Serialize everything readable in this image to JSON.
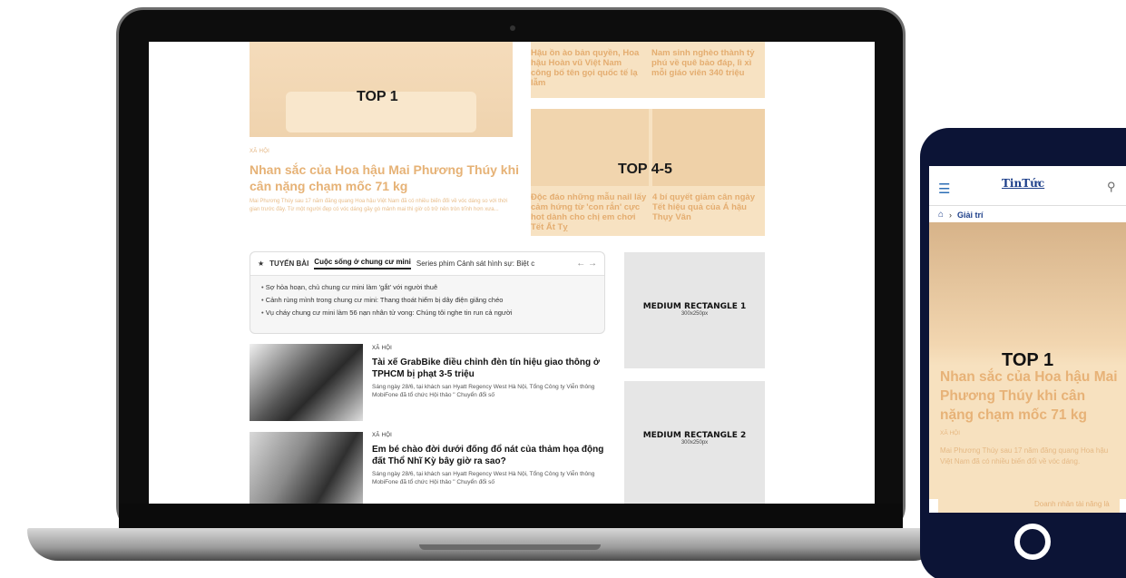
{
  "laptop": {
    "top1_label": "TOP 1",
    "top1_category": "XÃ HỘI",
    "top1_headline": "Nhan sắc của Hoa hậu Mai Phương Thúy khi cân nặng chạm mốc 71 kg",
    "top1_desc": "Mai Phương Thúy sau 17 năm đăng quang Hoa hậu Việt Nam đã có nhiều biến đổi về vóc dáng so với thời gian trước đây. Từ một người đẹp có vóc dáng gầy gò mảnh mai thì giờ cô trở nên tròn trĩnh hơn xưa...",
    "right_top_1": "Hậu ồn ào bản quyền, Hoa hậu Hoàn vũ Việt Nam công bố tên gọi quốc tế lạ lẫm",
    "right_top_2": "Nam sinh nghèo thành tỷ phú về quê bảo đáp, lì xì mỗi giáo viên 340 triệu",
    "top45_label": "TOP 4-5",
    "top45_story_1": "Độc đáo những mẫu nail lấy cảm hứng từ 'con rắn' cực hot dành cho chị em chơi Tết Ất Tỵ",
    "top45_story_2": "4 bí quyết giảm cân ngày Tết hiệu quả của Á hậu Thụy Vân",
    "series": {
      "star": "★",
      "label": "TUYẾN BÀI",
      "tab_active": "Cuộc sống ở chung cư mini",
      "tab_other": "Series phim Cảnh sát hình sự: Biệt c",
      "arrows": "← →",
      "items": [
        "Sợ hỏa hoạn, chủ chung cư mini làm 'gắt' với người thuê",
        "Cảnh rùng mình trong chung cư mini: Thang thoát hiểm bị dây điện giăng chéo",
        "Vụ cháy chung cư mini làm 56 nạn nhân tử vong: Chúng tôi nghe tin run cả người"
      ]
    },
    "ads": [
      {
        "title": "MEDIUM RECTANGLE 1",
        "size": "300x250px"
      },
      {
        "title": "MEDIUM RECTANGLE 2",
        "size": "300x250px"
      }
    ],
    "news": [
      {
        "category": "XÃ HỘI",
        "title": "Tài xế GrabBike điều chỉnh đèn tín hiệu giao thông ở TPHCM bị phạt 3-5 triệu",
        "desc": "Sáng ngày 28/6, tại khách sạn Hyatt Regency West Hà Nội, Tổng Công ty Viễn thông MobiFone đã tổ chức Hội thảo \" Chuyển đổi số"
      },
      {
        "category": "XÃ HỘI",
        "title": "Em bé chào đời dưới đống đổ nát của thảm họa động đất Thổ Nhĩ Kỳ bây giờ ra sao?",
        "desc": "Sáng ngày 28/6, tại khách sạn Hyatt Regency West Hà Nội, Tổng Công ty Viễn thông MobiFone đã tổ chức Hội thảo \" Chuyển đổi số"
      }
    ]
  },
  "phone": {
    "menu_icon": "☰",
    "logo": "TinTức",
    "search_icon": "⚲",
    "breadcrumb_home": "⌂",
    "breadcrumb_sep": "›",
    "breadcrumb_label": "Giải trí",
    "top_label": "TOP 1",
    "headline": "Nhan sắc của Hoa hậu Mai Phương Thúy khi cân nặng chạm mốc 71 kg",
    "category": "XÃ HỘI",
    "desc": "Mai Phương Thúy sau 17 năm đăng quang Hoa hậu Việt Nam đã có nhiều biến đổi về vóc dáng.",
    "next_story": "Doanh nhân tài năng là"
  },
  "colors": {
    "overlay_tone": "#f7e2c2",
    "overlay_text": "#e6b276",
    "phone_frame": "#0c1436",
    "brand_blue": "#1d3f8a"
  }
}
